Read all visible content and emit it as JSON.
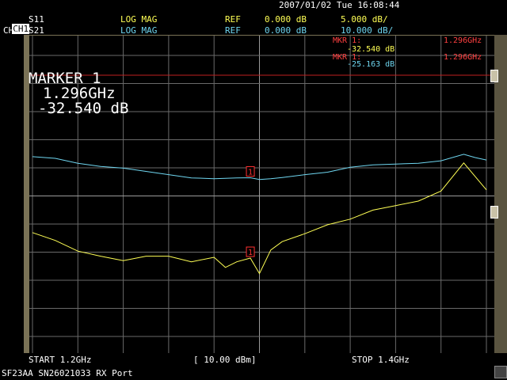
{
  "status_bar": {
    "datetime": "2007/01/02 Tue 16:08:44"
  },
  "channels": [
    {
      "id": "CH1",
      "param": "S11",
      "format": "LOG MAG",
      "ref_label": "REF",
      "ref_value": "0.000 dB",
      "scale": "5.000 dB/",
      "color": "#ffff55"
    },
    {
      "id": "CH2",
      "param": "S21",
      "format": "LOG MAG",
      "ref_label": "REF",
      "ref_value": "0.000 dB",
      "scale": "10.000 dB/",
      "color": "#6fd6f0"
    }
  ],
  "marker_readouts": [
    {
      "label": "MKR 1:",
      "freq": "1.296GHz",
      "value": "-32.540 dB"
    },
    {
      "label": "MKR 1:",
      "freq": "1.296GHz",
      "value": "-25.163 dB"
    }
  ],
  "marker_panel": {
    "title": "MARKER 1",
    "freq": "1.296GHz",
    "value": "-32.540 dB"
  },
  "marker_tag": "1",
  "footer": {
    "start": "START 1.2GHz",
    "power": "[ 10.00 dBm]",
    "stop": "STOP 1.4GHz"
  },
  "bottom_bar": {
    "text": "SF23AA SN26021033 RX Port"
  },
  "chart_data": {
    "type": "line",
    "x_start_ghz": 1.2,
    "x_stop_ghz": 1.4,
    "grid_divisions": [
      10,
      10
    ],
    "grid": true,
    "series": [
      {
        "name": "S11",
        "color": "#ffff55",
        "x_ghz": [
          1.2,
          1.21,
          1.22,
          1.23,
          1.24,
          1.25,
          1.26,
          1.27,
          1.28,
          1.285,
          1.29,
          1.296,
          1.3,
          1.305,
          1.31,
          1.32,
          1.33,
          1.34,
          1.35,
          1.36,
          1.37,
          1.38,
          1.39,
          1.4
        ],
        "y_db": [
          -28,
          -29.4,
          -31.3,
          -32.2,
          -33,
          -32.2,
          -32.2,
          -33.2,
          -32.4,
          -34.2,
          -33.2,
          -32.54,
          -35.3,
          -31.1,
          -29.6,
          -28.2,
          -26.6,
          -25.6,
          -24,
          -23.2,
          -22.4,
          -20.6,
          -15.6,
          -20.4
        ]
      },
      {
        "name": "S21",
        "color": "#6fd6f0",
        "x_ghz": [
          1.2,
          1.21,
          1.22,
          1.23,
          1.24,
          1.25,
          1.26,
          1.27,
          1.28,
          1.29,
          1.296,
          1.3,
          1.305,
          1.31,
          1.32,
          1.33,
          1.34,
          1.35,
          1.36,
          1.37,
          1.38,
          1.39,
          1.395,
          1.4
        ],
        "y_db": [
          -20,
          -20.4,
          -21.6,
          -22.4,
          -22.8,
          -23.6,
          -24.4,
          -25.2,
          -25.4,
          -25.2,
          -25.16,
          -25.6,
          -25.4,
          -25.1,
          -24.4,
          -23.8,
          -22.6,
          -22,
          -21.8,
          -21.6,
          -21,
          -19.4,
          -20.2,
          -20.8
        ]
      }
    ]
  }
}
